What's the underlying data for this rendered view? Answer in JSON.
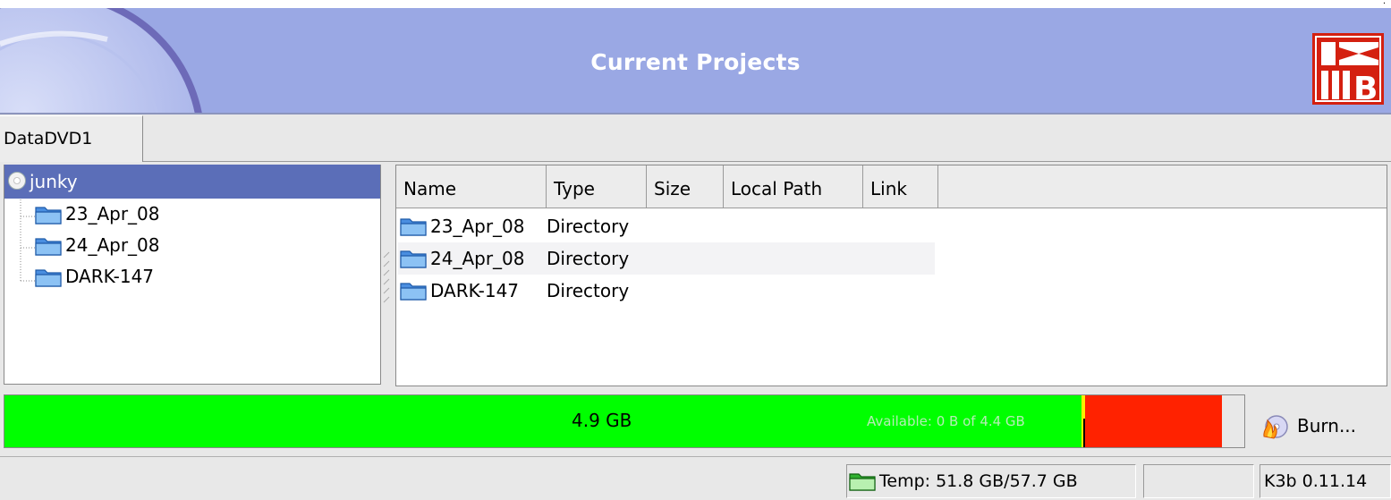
{
  "banner": {
    "title": "Current Projects",
    "logo_icon": "k3b-logo",
    "background_icon": "cd-disc-icon"
  },
  "tabs": [
    {
      "label": "DataDVD1",
      "active": true
    }
  ],
  "tree": {
    "root": {
      "label": "junky",
      "icon": "cd-icon"
    },
    "items": [
      {
        "label": "23_Apr_08",
        "icon": "folder-icon"
      },
      {
        "label": "24_Apr_08",
        "icon": "folder-icon"
      },
      {
        "label": "DARK-147",
        "icon": "folder-icon"
      }
    ]
  },
  "file_list": {
    "columns": [
      "Name",
      "Type",
      "Size",
      "Local Path",
      "Link"
    ],
    "rows": [
      {
        "name": "23_Apr_08",
        "type": "Directory"
      },
      {
        "name": "24_Apr_08",
        "type": "Directory"
      },
      {
        "name": "DARK-147",
        "type": "Directory"
      }
    ]
  },
  "capacity": {
    "used_label": "4.9 GB",
    "available_label": "Available: 0 B of 4.4 GB",
    "used_fraction": 0.8685,
    "overflow_fraction": 0.1138,
    "fill_color": "#00ff00",
    "overflow_color": "#ff2200"
  },
  "burn_button": {
    "label": "Burn...",
    "icon": "burn-icon"
  },
  "status": {
    "temp": "Temp: 51.8 GB/57.7 GB",
    "temp_icon": "folder-icon",
    "empty": "",
    "version": "K3b 0.11.14"
  }
}
